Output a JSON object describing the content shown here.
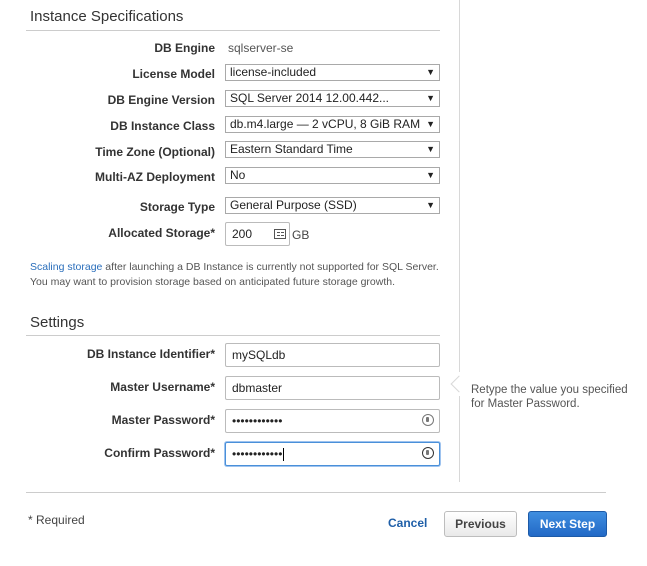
{
  "instance_specs": {
    "title": "Instance Specifications",
    "db_engine": {
      "label": "DB Engine",
      "value": "sqlserver-se"
    },
    "license_model": {
      "label": "License Model",
      "value": "license-included"
    },
    "engine_version": {
      "label": "DB Engine Version",
      "value": "SQL Server 2014 12.00.442..."
    },
    "instance_class": {
      "label": "DB Instance Class",
      "value": "db.m4.large — 2 vCPU, 8 GiB RAM"
    },
    "time_zone": {
      "label": "Time Zone (Optional)",
      "value": "Eastern Standard Time"
    },
    "multi_az": {
      "label": "Multi-AZ Deployment",
      "value": "No"
    },
    "storage_type": {
      "label": "Storage Type",
      "value": "General Purpose (SSD)"
    },
    "allocated_storage": {
      "label": "Allocated Storage*",
      "value": "200",
      "unit": "GB"
    },
    "note": {
      "link": "Scaling storage",
      "text": " after launching a DB Instance is currently not supported for SQL Server. You may want to provision storage based on anticipated future storage growth."
    }
  },
  "settings": {
    "title": "Settings",
    "identifier": {
      "label": "DB Instance Identifier*",
      "value": "mySQLdb"
    },
    "username": {
      "label": "Master Username*",
      "value": "dbmaster"
    },
    "password": {
      "label": "Master Password*",
      "value": "••••••••••••"
    },
    "confirm": {
      "label": "Confirm Password*",
      "value": "••••••••••••"
    },
    "hint": "Retype the value you specified for Master Password."
  },
  "footer": {
    "required": "* Required",
    "cancel": "Cancel",
    "previous": "Previous",
    "next": "Next Step"
  },
  "icons": {
    "dropdown_arrow": "▼"
  },
  "colors": {
    "primary_button": "#2269c6",
    "link": "#2a6ebb"
  }
}
